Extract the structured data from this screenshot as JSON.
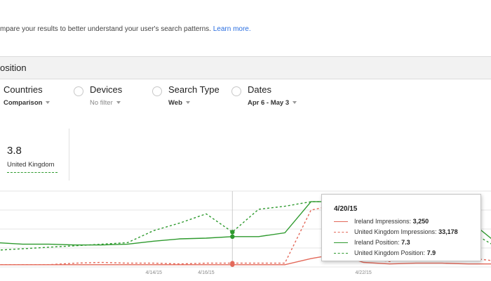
{
  "intro": {
    "text": "mpare your results to better understand your user's search patterns.",
    "link": "Learn more."
  },
  "section_bar": {
    "label": "osition"
  },
  "filters": [
    {
      "title": "Countries",
      "value": "Comparison",
      "muted": false
    },
    {
      "title": "Devices",
      "value": "No filter",
      "muted": true
    },
    {
      "title": "Search Type",
      "value": "Web",
      "muted": false
    },
    {
      "title": "Dates",
      "value": "Apr 6 - May 3",
      "muted": false
    }
  ],
  "metric": {
    "value": "3.8",
    "label": "United Kingdom"
  },
  "colors": {
    "red": "#e3695a",
    "green": "#2e9a2e",
    "grid": "#e6e6e6"
  },
  "chart_data": {
    "type": "line",
    "x": [
      "4/8/15",
      "4/9/15",
      "4/10/15",
      "4/11/15",
      "4/12/15",
      "4/13/15",
      "4/14/15",
      "4/15/15",
      "4/16/15",
      "4/17/15",
      "4/18/15",
      "4/19/15",
      "4/20/15",
      "4/21/15",
      "4/22/15",
      "4/23/15",
      "4/24/15",
      "4/25/15",
      "4/26/15",
      "4/27/15"
    ],
    "x_tick_labels": [
      {
        "x": "4/14/15",
        "label": "4/14/15"
      },
      {
        "x": "4/16/15",
        "label": "4/16/15"
      },
      {
        "x": "4/22/15",
        "label": "4/22/15"
      }
    ],
    "series": [
      {
        "name": "Ireland Impressions",
        "style": "red-solid",
        "values": [
          0.03,
          0.03,
          0.03,
          0.03,
          0.03,
          0.03,
          0.03,
          0.03,
          0.03,
          0.03,
          0.03,
          0.03,
          0.11,
          0.17,
          0.06,
          0.04,
          0.05,
          0.05,
          0.04,
          0.04
        ]
      },
      {
        "name": "United Kingdom Impressions",
        "style": "red-dash",
        "values": [
          0.03,
          0.03,
          0.03,
          0.05,
          0.06,
          0.05,
          0.05,
          0.04,
          0.05,
          0.05,
          0.05,
          0.05,
          0.75,
          0.82,
          0.12,
          0.07,
          0.15,
          0.18,
          0.12,
          0.08
        ]
      },
      {
        "name": "Ireland Position",
        "style": "green-solid",
        "values": [
          0.32,
          0.3,
          0.3,
          0.29,
          0.29,
          0.3,
          0.34,
          0.37,
          0.38,
          0.4,
          0.4,
          0.45,
          0.86,
          0.86,
          0.86,
          0.55,
          0.66,
          0.66,
          0.62,
          0.34
        ]
      },
      {
        "name": "United Kingdom Position",
        "style": "green-dash",
        "values": [
          0.22,
          0.24,
          0.26,
          0.28,
          0.3,
          0.32,
          0.48,
          0.58,
          0.7,
          0.46,
          0.76,
          0.8,
          0.86,
          0.86,
          0.6,
          0.55,
          0.6,
          0.6,
          0.48,
          0.28
        ]
      }
    ],
    "hover_index": 9
  },
  "tooltip": {
    "date": "4/20/15",
    "rows": [
      {
        "label": "Ireland Impressions:",
        "value": "3,250",
        "style": "red-solid"
      },
      {
        "label": "United Kingdom Impressions:",
        "value": "33,178",
        "style": "red-dash"
      },
      {
        "label": "Ireland Position:",
        "value": "7.3",
        "style": "green-solid"
      },
      {
        "label": "United Kingdom Position:",
        "value": "7.9",
        "style": "green-dash"
      }
    ]
  }
}
